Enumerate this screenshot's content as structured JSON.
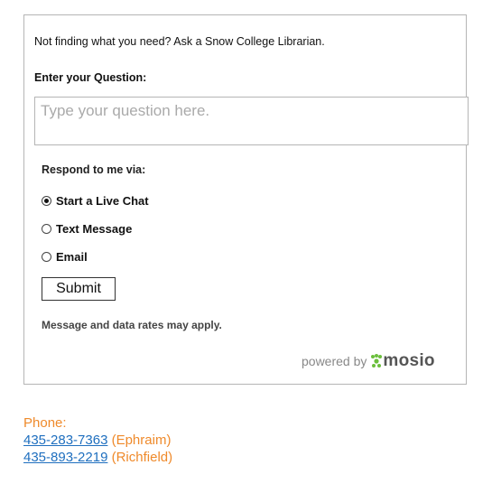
{
  "widget": {
    "intro": "Not finding what you need? Ask a Snow College Librarian.",
    "question_label": "Enter your Question:",
    "question_placeholder": "Type your question here.",
    "respond_label": "Respond to me via:",
    "options": [
      {
        "label": "Start a Live Chat",
        "selected": true
      },
      {
        "label": "Text Message",
        "selected": false
      },
      {
        "label": "Email",
        "selected": false
      }
    ],
    "submit_label": "Submit",
    "disclaimer": "Message and data rates may apply.",
    "powered_by": "powered by",
    "brand": "mosio",
    "brand_color": "#6bbf3c"
  },
  "contact": {
    "phone_label": "Phone:",
    "numbers": [
      {
        "number": "435-283-7363",
        "location": "(Ephraim)"
      },
      {
        "number": "435-893-2219",
        "location": "(Richfield)"
      }
    ],
    "label_color": "#ef8a2b",
    "link_color": "#1f6fbf"
  }
}
